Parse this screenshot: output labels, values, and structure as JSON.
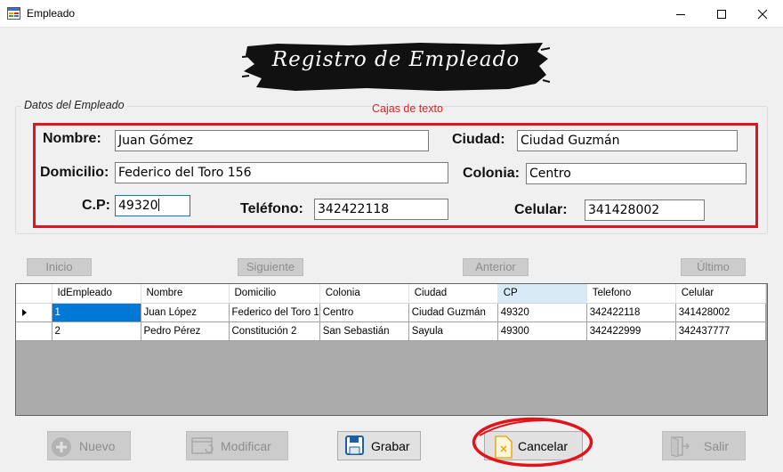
{
  "window": {
    "title": "Empleado"
  },
  "banner": {
    "title": "Registro de Empleado"
  },
  "group": {
    "legend": "Datos del Empleado"
  },
  "annotation": {
    "label": "Cajas de texto"
  },
  "form": {
    "nombre": {
      "label": "Nombre:",
      "value": "Juan Gómez"
    },
    "ciudad": {
      "label": "Ciudad:",
      "value": "Ciudad Guzmán"
    },
    "domicilio": {
      "label": "Domicilio:",
      "value": "Federico del Toro 156"
    },
    "colonia": {
      "label": "Colonia:",
      "value": "Centro"
    },
    "cp": {
      "label": "C.P:",
      "value": "49320"
    },
    "telefono": {
      "label": "Teléfono:",
      "value": "342422118"
    },
    "celular": {
      "label": "Celular:",
      "value": "341428002"
    }
  },
  "nav": {
    "inicio": "Inicio",
    "siguiente": "Siguiente",
    "anterior": "Anterior",
    "ultimo": "Último"
  },
  "grid": {
    "columns": [
      "IdEmpleado",
      "Nombre",
      "Domicilio",
      "Colonia",
      "Ciudad",
      "CP",
      "Telefono",
      "Celular"
    ],
    "rows": [
      [
        "1",
        "Juan López",
        "Federico del Toro 1",
        "Centro",
        "Ciudad Guzmán",
        "49320",
        "342422118",
        "341428002"
      ],
      [
        "2",
        "Pedro Pérez",
        "Constitución 2",
        "San Sebastián",
        "Sayula",
        "49300",
        "342422999",
        "342437777"
      ]
    ]
  },
  "buttons": {
    "nuevo": "Nuevo",
    "modificar": "Modificar",
    "grabar": "Grabar",
    "cancelar": "Cancelar",
    "salir": "Salir"
  },
  "colors": {
    "annotation_red": "#e3131b",
    "selection_blue": "#0078d7",
    "grid_background": "#ababab"
  }
}
